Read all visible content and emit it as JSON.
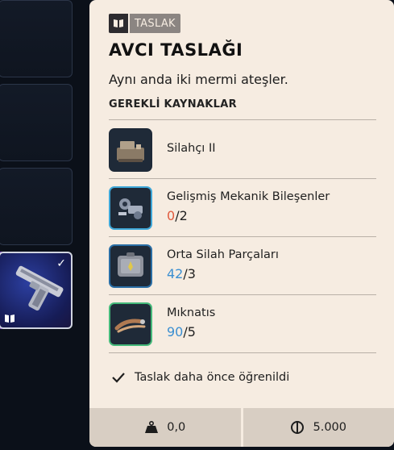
{
  "blueprint": {
    "badge_icon": "book-icon",
    "badge_label": "TASLAK",
    "title": "AVCI TASLAĞI",
    "description": "Aynı anda iki mermi ateşler.",
    "required_header": "GEREKLİ KAYNAKLAR",
    "resources": [
      {
        "name": "Silahçı II",
        "have": "",
        "slash": "",
        "need": "",
        "icon": "workbench-icon"
      },
      {
        "name": "Gelişmiş Mekanik Bileşenler",
        "have": "0",
        "slash": "/",
        "need": "2",
        "icon": "mechanical-parts-icon"
      },
      {
        "name": "Orta Silah Parçaları",
        "have": "42",
        "slash": "/",
        "need": "3",
        "icon": "weapon-parts-case-icon"
      },
      {
        "name": "Mıknatıs",
        "have": "90",
        "slash": "/",
        "need": "5",
        "icon": "magnet-icon"
      }
    ],
    "learned_icon": "checkmark-icon",
    "learned_text": "Taslak daha önce öğrenildi",
    "weight_icon": "weight-icon",
    "weight_value": "0,0",
    "price_icon": "coin-icon",
    "price_value": "5.000"
  },
  "inventory": {
    "selected_slot_check": "✓",
    "selected_slot_icon": "book-icon"
  },
  "colors": {
    "card_bg": "#f6ece1",
    "missing": "#e15b3f",
    "owned": "#3b8fd1"
  }
}
